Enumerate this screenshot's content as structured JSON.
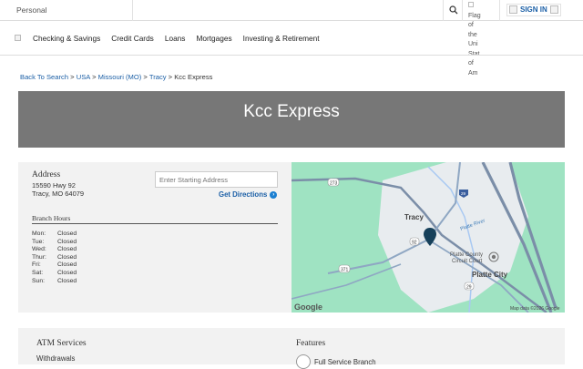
{
  "topbar": {
    "segment": "Personal",
    "signin": "SIGN IN",
    "flag_alt": [
      "Flag",
      "of",
      "the",
      "Uni",
      "Stat",
      "of",
      "Am"
    ]
  },
  "nav": {
    "items": [
      "Checking & Savings",
      "Credit Cards",
      "Loans",
      "Mortgages",
      "Investing & Retirement"
    ]
  },
  "breadcrumb": {
    "items": [
      "Back To Search",
      "USA",
      "Missouri (MO)",
      "Tracy"
    ],
    "current": "Kcc Express",
    "separator": ">"
  },
  "hero": {
    "title": "Kcc Express"
  },
  "branch": {
    "address_label": "Address",
    "address_line1": "15590 Hwy 92",
    "address_line2": "Tracy, MO 64079",
    "start_placeholder": "Enter Starting Address",
    "get_directions": "Get Directions",
    "hours_label": "Branch Hours",
    "hours": [
      {
        "day": "Mon:",
        "status": "Closed"
      },
      {
        "day": "Tue:",
        "status": "Closed"
      },
      {
        "day": "Wed:",
        "status": "Closed"
      },
      {
        "day": "Thur:",
        "status": "Closed"
      },
      {
        "day": "Fri:",
        "status": "Closed"
      },
      {
        "day": "Sat:",
        "status": "Closed"
      },
      {
        "day": "Sun:",
        "status": "Closed"
      }
    ]
  },
  "map": {
    "labels": {
      "tracy": "Tracy",
      "platte_river": "Platte River",
      "court1": "Platte County",
      "court2": "Circuit Court",
      "platte_city": "Platte City",
      "hwy_273": "273",
      "hwy_92": "92",
      "hwy_371": "371",
      "hwy_29": "29",
      "hwy_i29": "29"
    },
    "google": "Google",
    "attribution": "Map data ©2026 Google",
    "colors": {
      "land": "#9fe3c2",
      "urban": "#e8ecef",
      "road": "#8fa7c3",
      "highway": "#7b8ea8",
      "river": "#a9c9f2",
      "pin": "#16405a"
    }
  },
  "services": {
    "atm_title": "ATM Services",
    "atm_item": "Withdrawals",
    "features_title": "Features",
    "features_item": "Full Service Branch"
  }
}
